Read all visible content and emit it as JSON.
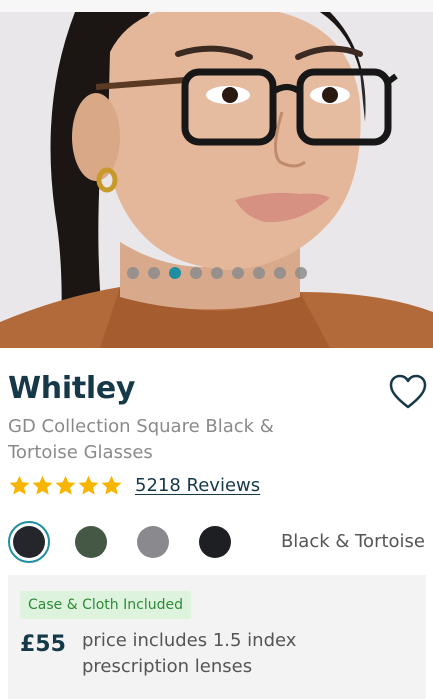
{
  "product": {
    "name": "Whitley",
    "subtitle": "GD Collection Square Black & Tortoise Glasses",
    "rating": 5,
    "reviews_label": "5218 Reviews",
    "selected_color": "Black & Tortoise"
  },
  "gallery": {
    "dot_count": 9,
    "active_index": 2
  },
  "colors": {
    "swatches": [
      "#24262b",
      "#455846",
      "#8a8a8e",
      "#1e1f22"
    ],
    "accent": "#1f8ea3",
    "star": "#f7b500"
  },
  "pricing": {
    "badge": "Case & Cloth Included",
    "price": "£55",
    "note": "price includes 1.5 index prescription lenses"
  },
  "icons": {
    "favorite": "heart-outline-icon",
    "star": "star-icon"
  }
}
